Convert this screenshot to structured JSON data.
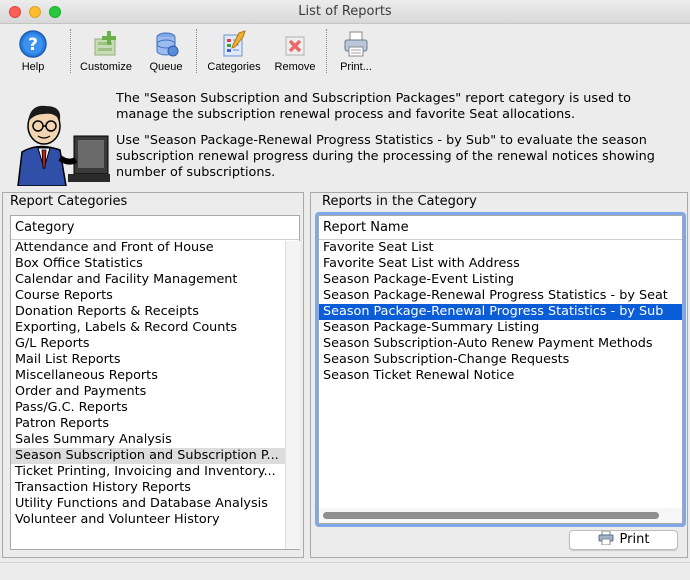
{
  "window": {
    "title": "List of Reports"
  },
  "toolbar": {
    "help": "Help",
    "customize": "Customize",
    "queue": "Queue",
    "categories": "Categories",
    "remove": "Remove",
    "print": "Print..."
  },
  "info": {
    "paragraph1": "The \"Season Subscription and Subscription Packages\" report category is used to manage the subscription renewal process and favorite Seat allocations.",
    "paragraph2": "Use \"Season Package-Renewal Progress Statistics - by Sub\" to evaluate the season subscription renewal progress during the processing of the renewal notices showing number of subscriptions."
  },
  "categories_pane": {
    "title": "Report Categories",
    "header": "Category",
    "selected_index": 13,
    "items": [
      "Attendance and Front of House",
      "Box Office Statistics",
      "Calendar and Facility Management",
      "Course Reports",
      "Donation Reports & Receipts",
      "Exporting, Labels & Record Counts",
      "G/L Reports",
      "Mail List Reports",
      "Miscellaneous Reports",
      "Order and Payments",
      "Pass/G.C. Reports",
      "Patron Reports",
      "Sales Summary Analysis",
      "Season Subscription and Subscription P...",
      "Ticket Printing, Invoicing and Inventory...",
      "Transaction History Reports",
      "Utility Functions and Database Analysis",
      "Volunteer and Volunteer History"
    ]
  },
  "reports_pane": {
    "title": "Reports in the Category",
    "header": "Report Name",
    "selected_index": 4,
    "items": [
      "Favorite Seat List",
      "Favorite Seat List with Address",
      "Season Package-Event Listing",
      "Season Package-Renewal Progress Statistics - by Seat",
      "Season Package-Renewal Progress Statistics - by Sub",
      "Season Package-Summary Listing",
      "Season Subscription-Auto Renew Payment Methods",
      "Season Subscription-Change Requests",
      "Season Ticket Renewal Notice"
    ]
  },
  "print_button": {
    "label": "Print"
  },
  "colors": {
    "selection_blue": "#0a5dd7",
    "selection_grey": "#dcdcdc"
  },
  "icons": [
    "help-icon",
    "customize-icon",
    "queue-icon",
    "categories-icon",
    "remove-icon",
    "printer-icon"
  ]
}
